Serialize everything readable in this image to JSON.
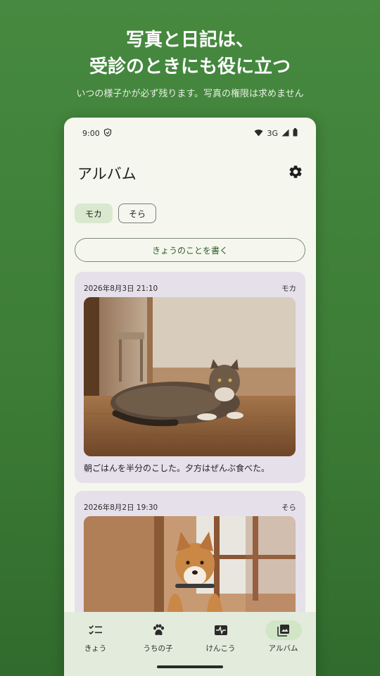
{
  "promo": {
    "headline_line1": "写真と日記は、",
    "headline_line2": "受診のときにも役に立つ",
    "subline": "いつの様子かが必ず残ります。写真の権限は求めません"
  },
  "status_bar": {
    "time": "9:00",
    "network": "3G"
  },
  "app_bar": {
    "title": "アルバム",
    "settings_icon": "gear-icon"
  },
  "pet_filter": {
    "chips": [
      {
        "label": "モカ",
        "selected": true
      },
      {
        "label": "そら",
        "selected": false
      }
    ]
  },
  "write_button_label": "きょうのことを書く",
  "entries": [
    {
      "date": "2026年8月3日 21:10",
      "pet": "モカ",
      "photo": "cat-lying-on-wooden-floor",
      "text": "朝ごはんを半分のこした。夕方はぜんぶ食べた。"
    },
    {
      "date": "2026年8月2日 19:30",
      "pet": "そら",
      "photo": "shiba-dog-sitting-indoors",
      "text": ""
    }
  ],
  "bottom_nav": [
    {
      "label": "きょう",
      "icon": "checklist-icon",
      "active": false
    },
    {
      "label": "うちの子",
      "icon": "paw-icon",
      "active": false
    },
    {
      "label": "けんこう",
      "icon": "pulse-icon",
      "active": false
    },
    {
      "label": "アルバム",
      "icon": "photo-album-icon",
      "active": true
    }
  ],
  "colors": {
    "background_green": "#3d7d37",
    "surface": "#f5f7ee",
    "selected_chip": "#d9e9cf",
    "card": "#e6e0ea",
    "nav_bar": "#e3ebdc",
    "nav_active_pill": "#d1e6c6"
  }
}
